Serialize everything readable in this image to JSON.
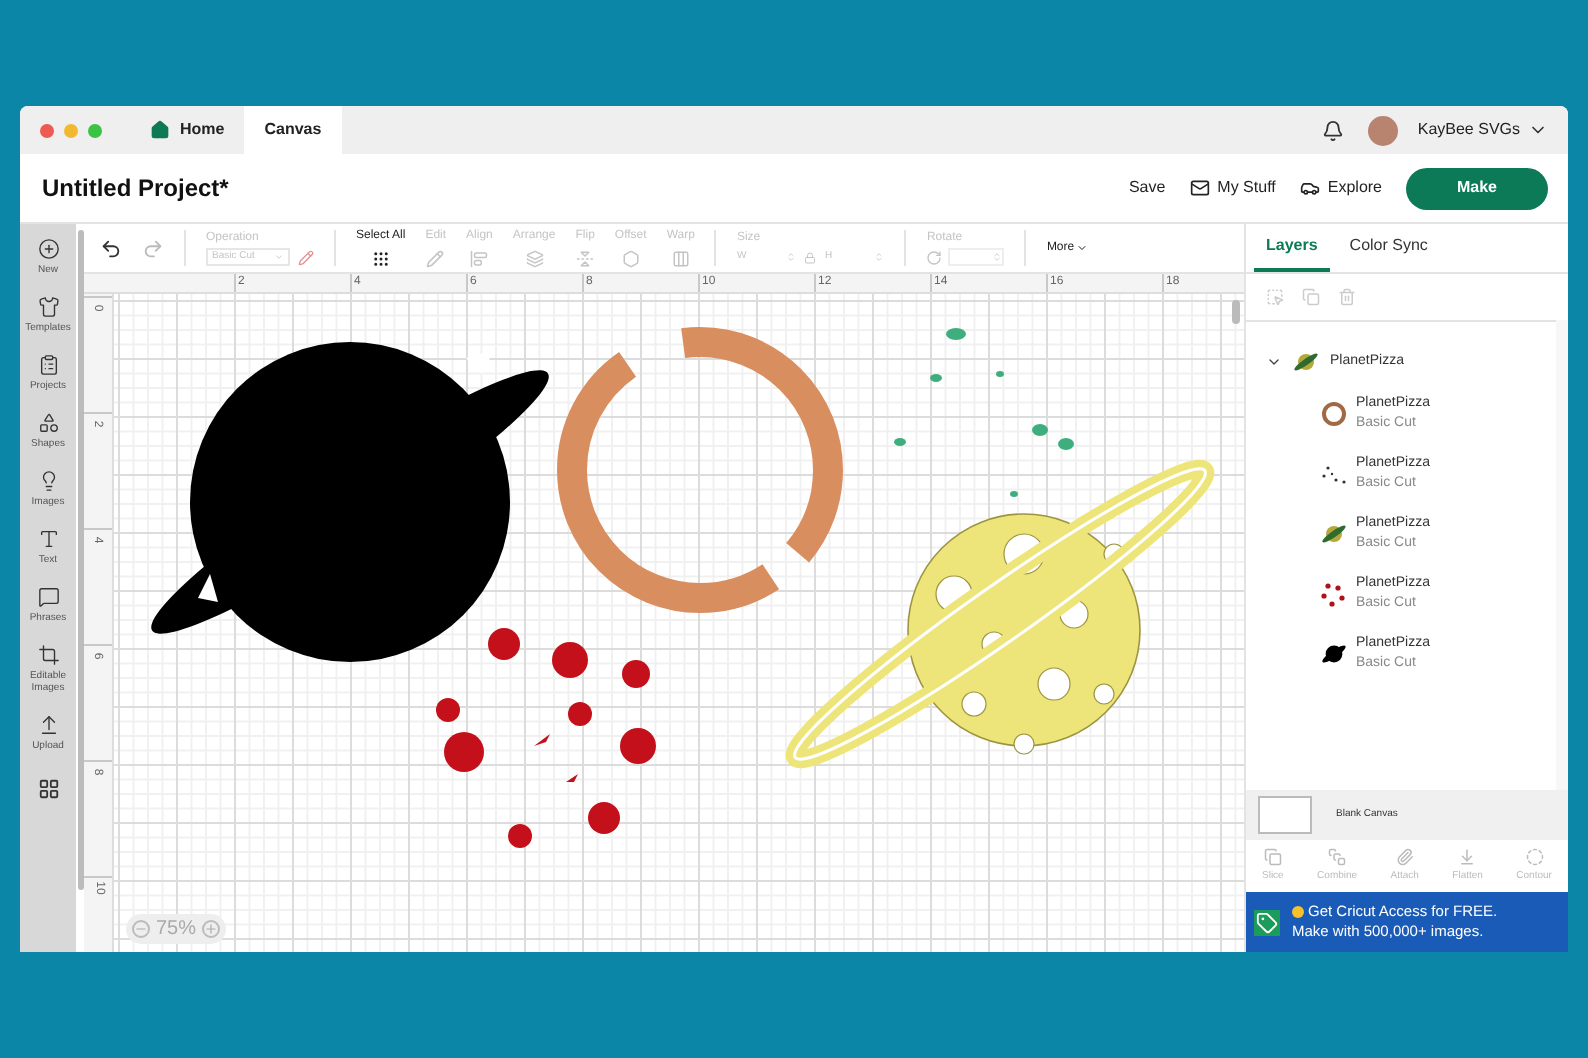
{
  "window": {
    "tabs": [
      {
        "label": "Home",
        "selected": false
      },
      {
        "label": "Canvas",
        "selected": true
      }
    ],
    "account": {
      "name": "KayBee SVGs"
    }
  },
  "header": {
    "title": "Untitled Project*",
    "links": [
      "Save",
      "My Stuff",
      "Explore"
    ],
    "make_button": "Make"
  },
  "sidebar": {
    "items": [
      {
        "label": "New"
      },
      {
        "label": "Templates"
      },
      {
        "label": "Projects"
      },
      {
        "label": "Shapes"
      },
      {
        "label": "Images"
      },
      {
        "label": "Text"
      },
      {
        "label": "Phrases"
      },
      {
        "label": "Editable Images"
      },
      {
        "label": "Upload"
      }
    ]
  },
  "toolbar": {
    "operation": {
      "label": "Operation",
      "value": "Basic Cut",
      "disabled": true
    },
    "tools": [
      {
        "label": "Select All",
        "disabled": false
      },
      {
        "label": "Edit",
        "disabled": true
      },
      {
        "label": "Align",
        "disabled": true
      },
      {
        "label": "Arrange",
        "disabled": true
      },
      {
        "label": "Flip",
        "disabled": true
      },
      {
        "label": "Offset",
        "disabled": true
      },
      {
        "label": "Warp",
        "disabled": true
      }
    ],
    "size": {
      "label": "Size",
      "width_label": "W",
      "height_label": "H"
    },
    "rotate": {
      "label": "Rotate"
    },
    "more": "More"
  },
  "canvas": {
    "top_ruler": [
      "2",
      "4",
      "6",
      "8",
      "10",
      "12",
      "14",
      "16",
      "18"
    ],
    "left_ruler": [
      "0",
      "2",
      "4",
      "6",
      "8",
      "10"
    ],
    "zoom": "75%"
  },
  "panel": {
    "tabs": [
      {
        "label": "Layers",
        "selected": true
      },
      {
        "label": "Color Sync",
        "selected": false
      }
    ],
    "group": {
      "name": "PlanetPizza",
      "expanded": true,
      "children": [
        {
          "name": "PlanetPizza",
          "operation": "Basic Cut",
          "kind": "ring"
        },
        {
          "name": "PlanetPizza",
          "operation": "Basic Cut",
          "kind": "specks"
        },
        {
          "name": "PlanetPizza",
          "operation": "Basic Cut",
          "kind": "planet"
        },
        {
          "name": "PlanetPizza",
          "operation": "Basic Cut",
          "kind": "dots"
        },
        {
          "name": "PlanetPizza",
          "operation": "Basic Cut",
          "kind": "silhouette"
        }
      ]
    },
    "blank_canvas": "Blank Canvas",
    "tools": [
      {
        "label": "Slice",
        "disabled": true
      },
      {
        "label": "Combine",
        "disabled": true
      },
      {
        "label": "Attach",
        "disabled": true
      },
      {
        "label": "Flatten",
        "disabled": true
      },
      {
        "label": "Contour",
        "disabled": true
      }
    ],
    "banner": {
      "line_1": "Get Cricut Access for FREE.",
      "line_2": "Make with 500,000+ images."
    }
  }
}
